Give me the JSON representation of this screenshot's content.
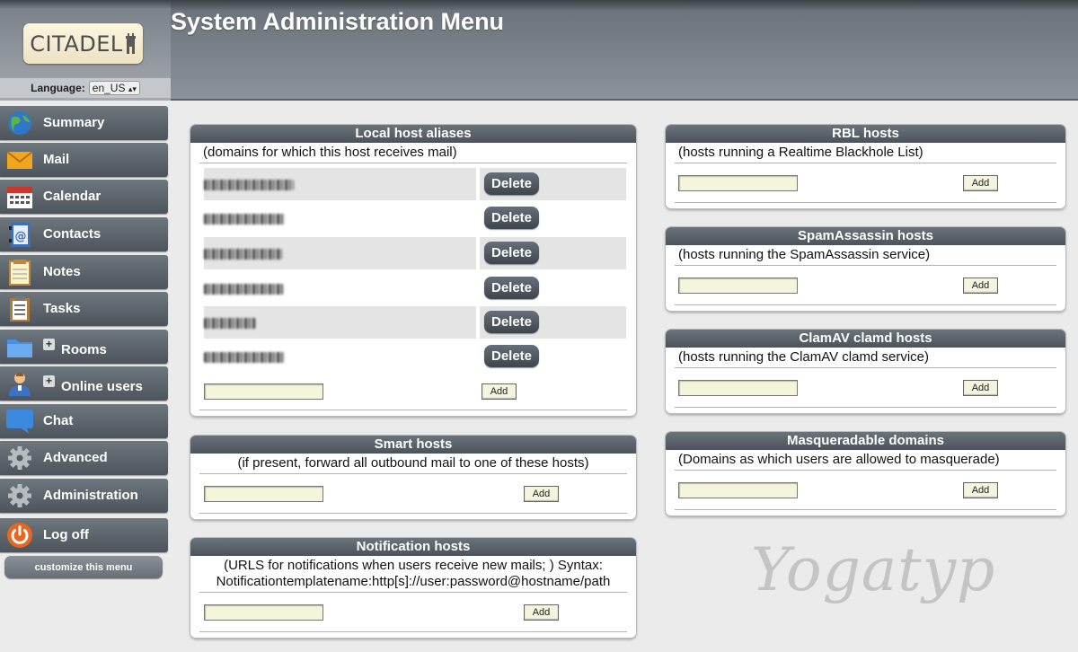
{
  "header": {
    "title": "System Administration Menu",
    "logo_text": "CITADEL",
    "language_label": "Language:",
    "language_value": "en_US"
  },
  "sidebar": {
    "items": [
      {
        "label": "Summary",
        "icon": "globe-icon",
        "expandable": false
      },
      {
        "label": "Mail",
        "icon": "envelope-icon",
        "expandable": false
      },
      {
        "label": "Calendar",
        "icon": "calendar-icon",
        "expandable": false
      },
      {
        "label": "Contacts",
        "icon": "address-book-icon",
        "expandable": false
      },
      {
        "label": "Notes",
        "icon": "notepad-icon",
        "expandable": false
      },
      {
        "label": "Tasks",
        "icon": "clipboard-icon",
        "expandable": false
      },
      {
        "label": "Rooms",
        "icon": "folder-icon",
        "expandable": true
      },
      {
        "label": "Online users",
        "icon": "user-icon",
        "expandable": true
      },
      {
        "label": "Chat",
        "icon": "speech-bubble-icon",
        "expandable": false
      },
      {
        "label": "Advanced",
        "icon": "gear-icon",
        "expandable": false
      },
      {
        "label": "Administration",
        "icon": "gear-icon",
        "expandable": false
      },
      {
        "label": "Log off",
        "icon": "power-icon",
        "expandable": false
      }
    ],
    "customize_label": "customize this menu"
  },
  "panels": {
    "local_aliases": {
      "title": "Local host aliases",
      "description": "(domains for which this host receives mail)",
      "delete_label": "Delete",
      "add_label": "Add",
      "row_count": 6
    },
    "smart_hosts": {
      "title": "Smart hosts",
      "description": "(if present, forward all outbound mail to one of these hosts)",
      "add_label": "Add"
    },
    "notification_hosts": {
      "title": "Notification hosts",
      "description_line1": "(URLS for notifications when users receive new mails; ) Syntax:",
      "description_line2": "Notificationtemplatename:http[s]://user:password@hostname/path",
      "add_label": "Add"
    },
    "rbl_hosts": {
      "title": "RBL hosts",
      "description": "(hosts running a Realtime Blackhole List)",
      "add_label": "Add"
    },
    "spamassassin_hosts": {
      "title": "SpamAssassin hosts",
      "description": "(hosts running the SpamAssassin service)",
      "add_label": "Add"
    },
    "clamav_hosts": {
      "title": "ClamAV clamd hosts",
      "description": "(hosts running the ClamAV clamd service)",
      "add_label": "Add"
    },
    "masquerade_domains": {
      "title": "Masqueradable domains",
      "description": "(Domains as which users are allowed to masquerade)",
      "add_label": "Add"
    }
  },
  "watermark": "Yogatyp",
  "colors": {
    "nav_bg": "#5a6168",
    "input_bg": "#f5f5dc",
    "row_alt": "#e4e4e4"
  }
}
